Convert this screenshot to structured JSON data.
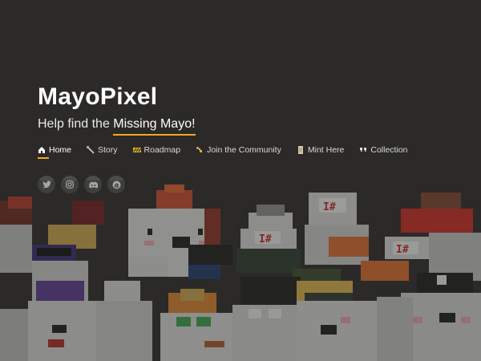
{
  "site": {
    "title": "MayoPixel",
    "subtitle_prefix": "Help find the ",
    "subtitle_highlight": "Missing Mayo!"
  },
  "nav": {
    "items": [
      {
        "label": "Home",
        "icon": "home-icon",
        "active": true
      },
      {
        "label": "Story",
        "icon": "quill-icon"
      },
      {
        "label": "Roadmap",
        "icon": "roadmap-icon"
      },
      {
        "label": "Join the Community",
        "icon": "community-icon"
      },
      {
        "label": "Mint Here",
        "icon": "scroll-icon"
      },
      {
        "label": "Collection",
        "icon": "quote-icon"
      }
    ]
  },
  "social": [
    "twitter-icon",
    "instagram-icon",
    "discord-icon",
    "opensea-icon"
  ],
  "art": {
    "signs": [
      "I#",
      "I#",
      "I#"
    ]
  },
  "colors": {
    "background": "#2b2a29",
    "accent": "#f2a81d"
  }
}
